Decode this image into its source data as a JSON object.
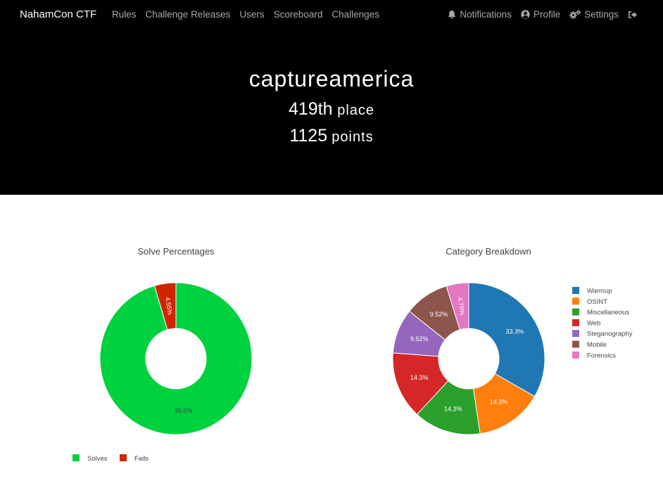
{
  "nav": {
    "brand": "NahamCon CTF",
    "left": [
      {
        "label": "Rules"
      },
      {
        "label": "Challenge Releases"
      },
      {
        "label": "Users"
      },
      {
        "label": "Scoreboard"
      },
      {
        "label": "Challenges"
      }
    ],
    "right": [
      {
        "label": "Notifications",
        "icon": "bell-icon"
      },
      {
        "label": "Profile",
        "icon": "user-circle-icon"
      },
      {
        "label": "Settings",
        "icon": "gears-icon"
      },
      {
        "label": "",
        "icon": "sign-out-icon"
      }
    ]
  },
  "hero": {
    "team": "captureamerica",
    "place_number": "419th",
    "place_label": "place",
    "points_number": "1125",
    "points_label": "points"
  },
  "charts_meta": {
    "solve": {
      "title": "Solve Percentages"
    },
    "category": {
      "title": "Category Breakdown"
    }
  },
  "chart_data": [
    {
      "type": "pie",
      "title": "Solve Percentages",
      "hole": true,
      "legend_placement": "bottom",
      "slices": [
        {
          "label": "Solves",
          "value": 95.5,
          "text": "95.5%",
          "color": "#00d13f"
        },
        {
          "label": "Fails",
          "value": 4.55,
          "text": "4.55%",
          "color": "#cf2600"
        }
      ]
    },
    {
      "type": "pie",
      "title": "Category Breakdown",
      "hole": true,
      "legend_placement": "right",
      "slices": [
        {
          "label": "Warmup",
          "value": 33.3,
          "text": "33.3%",
          "color": "#1f77b4"
        },
        {
          "label": "OSINT",
          "value": 14.3,
          "text": "14.3%",
          "color": "#ff7f0e"
        },
        {
          "label": "Miscellaneous",
          "value": 14.3,
          "text": "14.3%",
          "color": "#2ca02c"
        },
        {
          "label": "Web",
          "value": 14.3,
          "text": "14.3%",
          "color": "#d62728"
        },
        {
          "label": "Steganography",
          "value": 9.52,
          "text": "9.52%",
          "color": "#9467bd"
        },
        {
          "label": "Mobile",
          "value": 9.52,
          "text": "9.52%",
          "color": "#8c564b"
        },
        {
          "label": "Forensics",
          "value": 4.76,
          "text": "4.76%",
          "color": "#e377c2"
        }
      ]
    }
  ]
}
